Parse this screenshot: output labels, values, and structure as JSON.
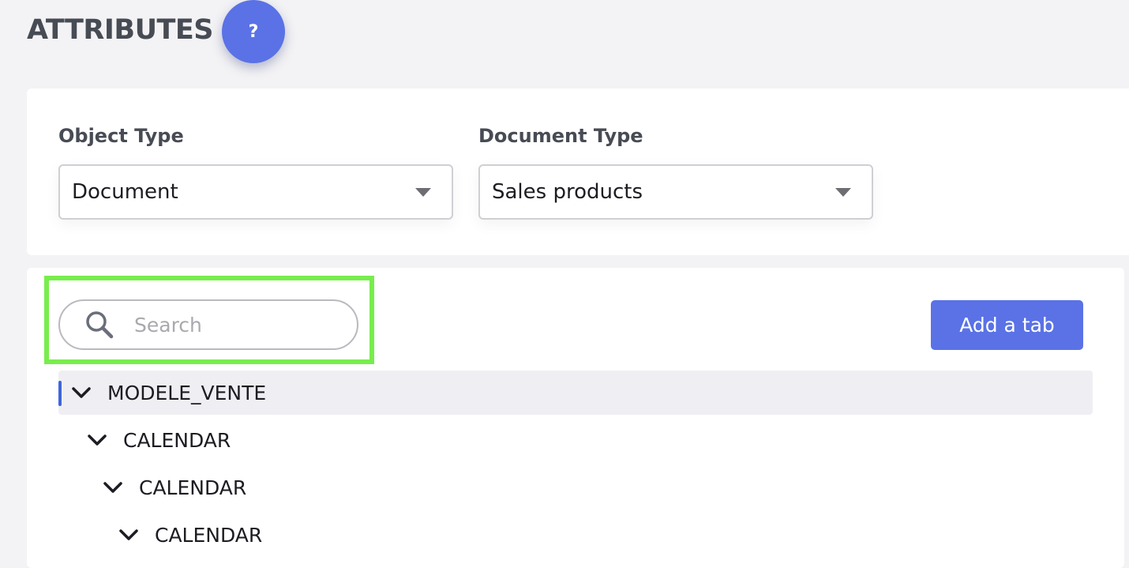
{
  "header": {
    "title": "ATTRIBUTES",
    "help_label": "?"
  },
  "filters": {
    "object_type": {
      "label": "Object Type",
      "value": "Document"
    },
    "document_type": {
      "label": "Document Type",
      "value": "Sales products"
    }
  },
  "search": {
    "placeholder": "Search",
    "value": ""
  },
  "toolbar": {
    "add_tab_label": "Add a tab"
  },
  "tree": {
    "nodes": [
      {
        "label": "MODELE_VENTE",
        "expanded": true,
        "selected": true
      },
      {
        "label": "CALENDAR",
        "expanded": true
      },
      {
        "label": "CALENDAR",
        "expanded": true
      },
      {
        "label": "CALENDAR",
        "expanded": true
      }
    ]
  },
  "colors": {
    "accent": "#5a72e6",
    "highlight": "#77ee4c",
    "selected_marker": "#3d66d9"
  }
}
